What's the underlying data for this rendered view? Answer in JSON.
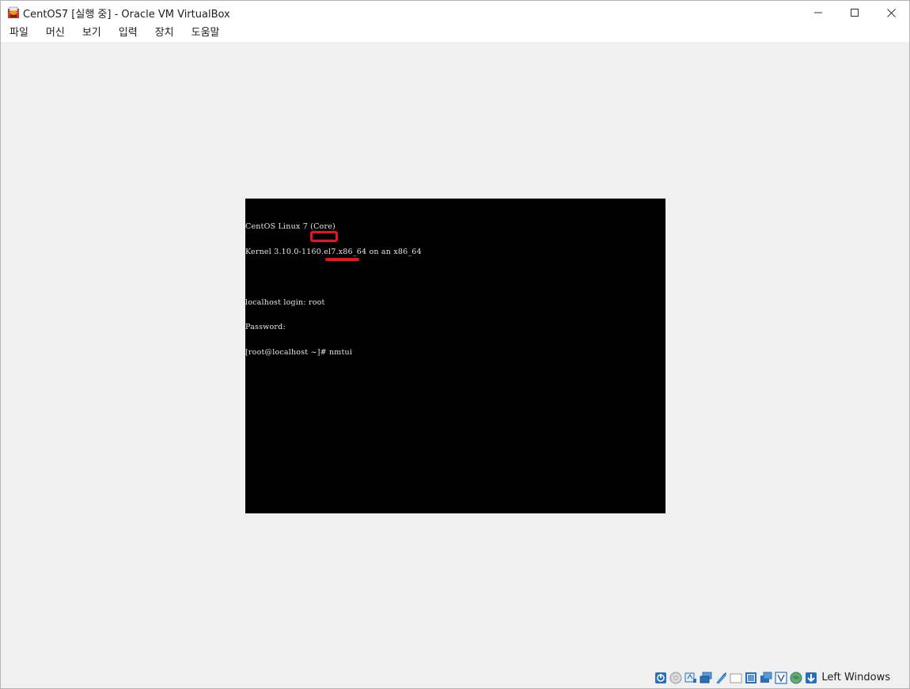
{
  "window": {
    "title": "CentOS7 [실행 중] - Oracle VM VirtualBox",
    "controls": {
      "minimize": "—",
      "maximize": "☐",
      "close": "✕"
    }
  },
  "menu": {
    "items": [
      {
        "label": "파일"
      },
      {
        "label": "머신"
      },
      {
        "label": "보기"
      },
      {
        "label": "입력"
      },
      {
        "label": "장치"
      },
      {
        "label": "도움말"
      }
    ]
  },
  "terminal": {
    "lines": [
      "CentOS Linux 7 (Core)",
      "Kernel 3.10.0-1160.el7.x86_64 on an x86_64",
      "",
      "localhost login: root",
      "Password:",
      "[root@localhost ~]# nmtui"
    ]
  },
  "status_bar": {
    "icons": [
      "hard-disk-icon",
      "optical-drive-icon",
      "audio-icon",
      "network-icon",
      "usb-icon",
      "shared-folders-icon",
      "display-icon",
      "video-capture-icon",
      "recording-icon",
      "cpu-vt-icon",
      "mouse-integration-icon",
      "keyboard-capture-icon"
    ],
    "host_key": "Left Windows"
  },
  "colors": {
    "window_bg": "#f0f0f0",
    "screen_bg": "#000000",
    "terminal_text": "#e6e6e6",
    "highlight": "#e8141c"
  }
}
